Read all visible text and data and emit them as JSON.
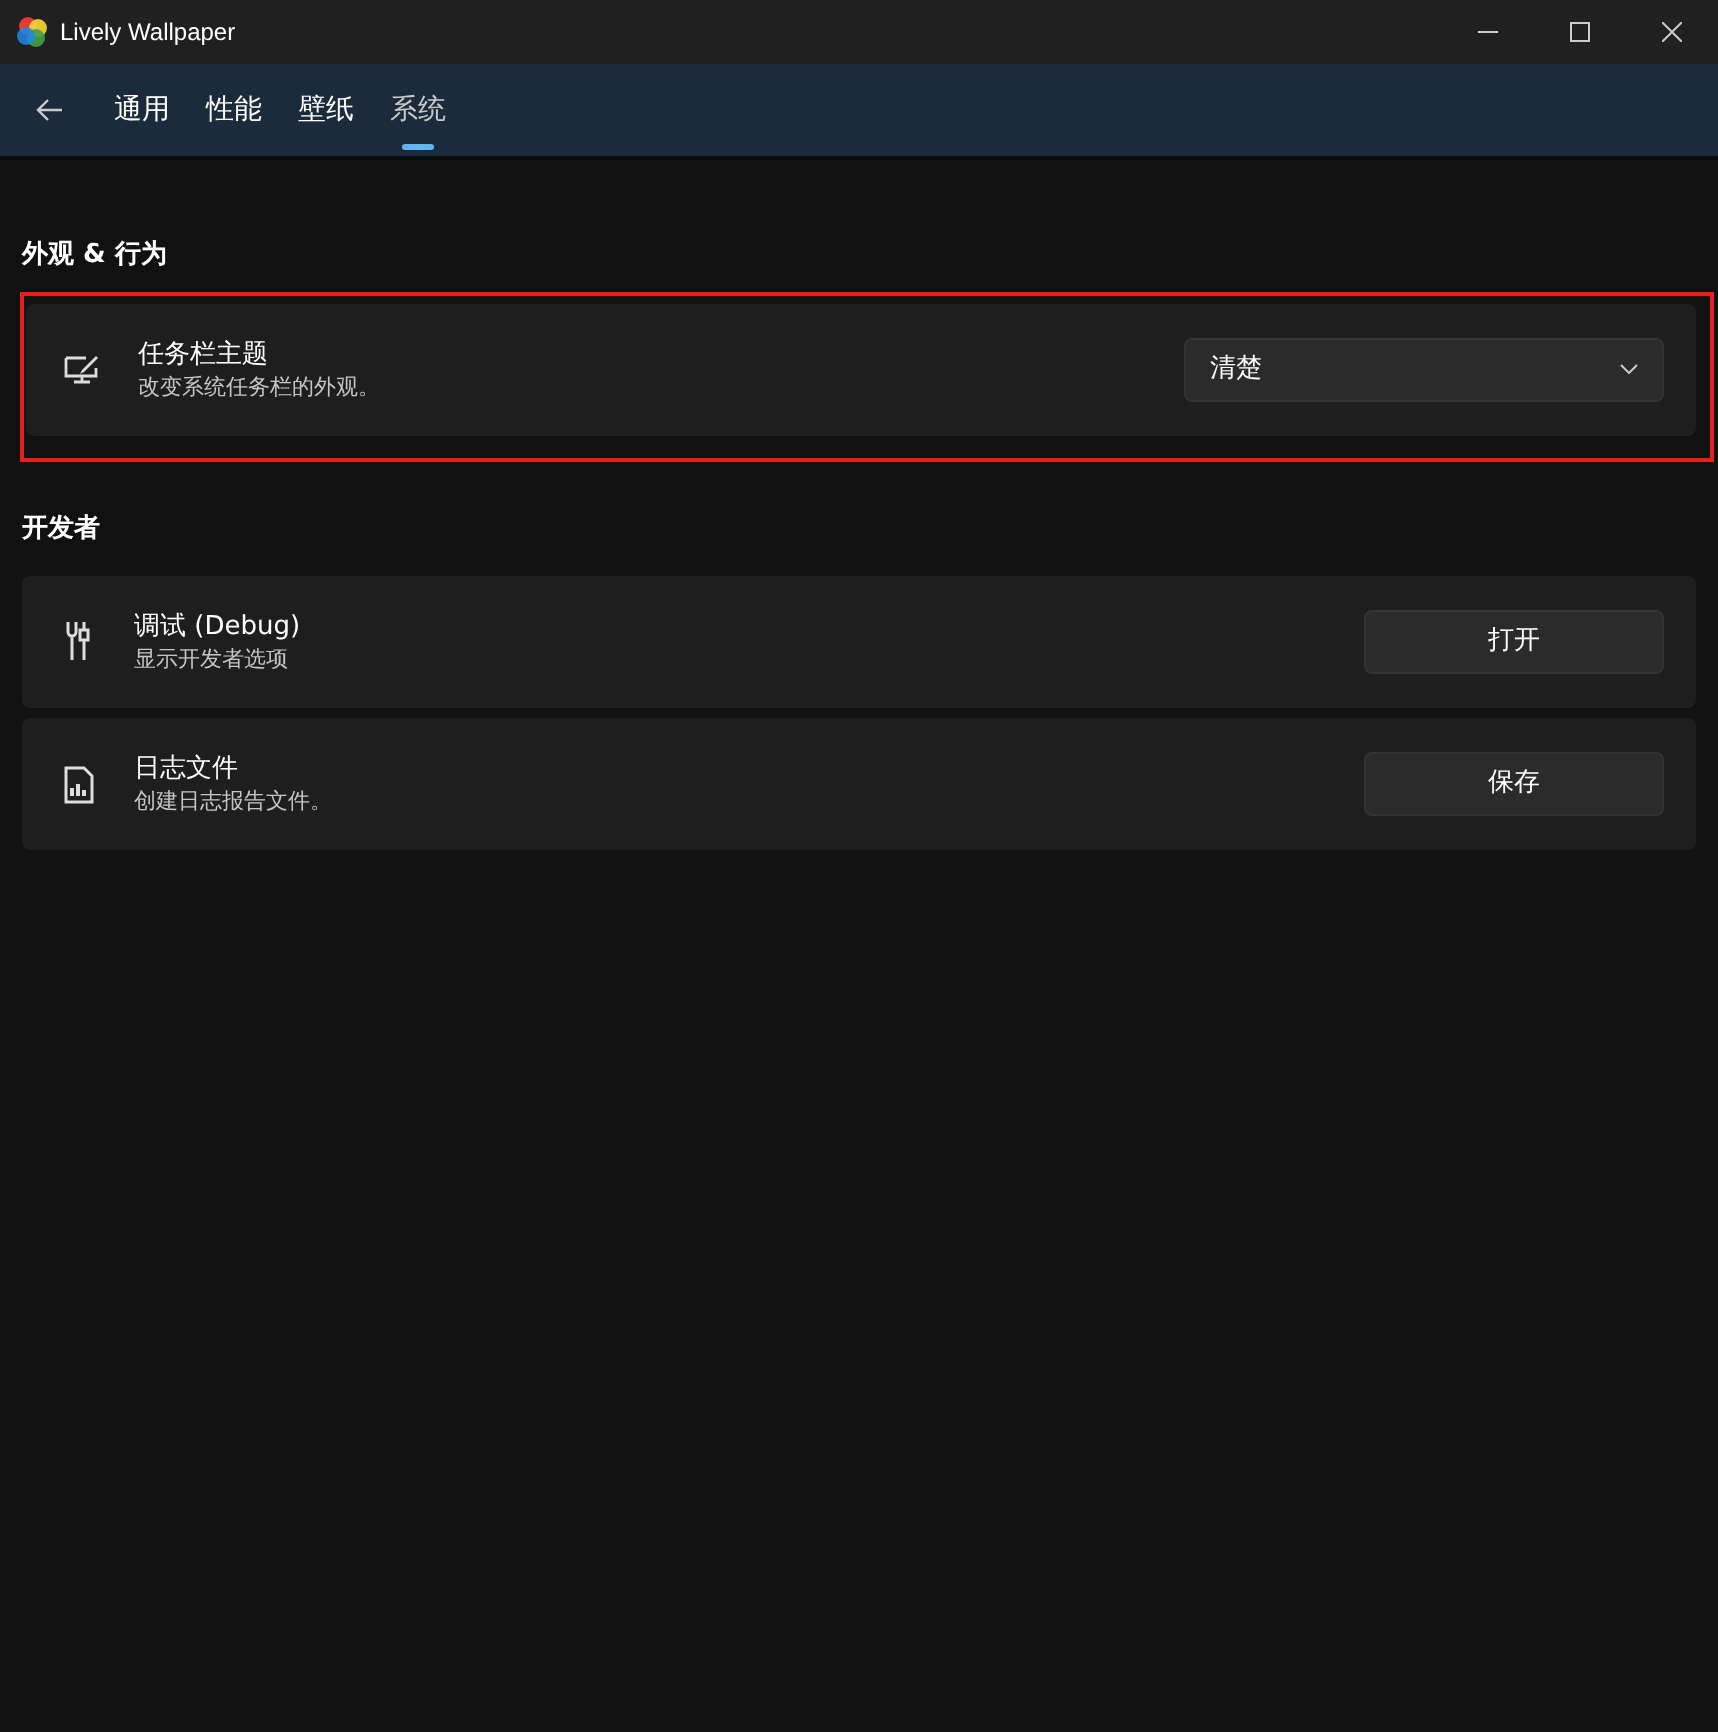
{
  "window": {
    "title": "Lively Wallpaper"
  },
  "tabs": [
    {
      "label": "通用",
      "selected": false
    },
    {
      "label": "性能",
      "selected": false
    },
    {
      "label": "壁纸",
      "selected": false
    },
    {
      "label": "系统",
      "selected": true
    }
  ],
  "sections": [
    {
      "heading": "外观 & 行为",
      "items": [
        {
          "kind": "dropdown",
          "title": "任务栏主题",
          "subtitle": "改变系统任务栏的外观。",
          "value": "清楚",
          "highlighted": true
        }
      ]
    },
    {
      "heading": "开发者",
      "items": [
        {
          "kind": "button",
          "title": "调试 (Debug)",
          "subtitle": "显示开发者选项",
          "value": "打开",
          "highlighted": false
        },
        {
          "kind": "button",
          "title": "日志文件",
          "subtitle": "创建日志报告文件。",
          "value": "保存",
          "highlighted": false
        }
      ]
    }
  ]
}
